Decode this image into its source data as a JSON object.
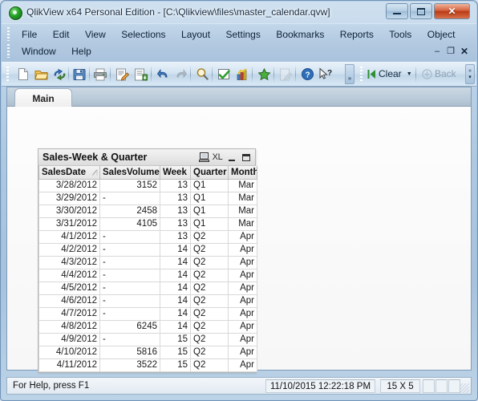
{
  "window": {
    "title": "QlikView x64 Personal Edition - [C:\\Qlikview\\files\\master_calendar.qvw]",
    "app_icon": "qlikview-logo-icon",
    "controls": {
      "minimize": "minimize-icon",
      "maximize": "maximize-icon",
      "close": "✕"
    }
  },
  "menu": {
    "row1": [
      "File",
      "Edit",
      "View",
      "Selections",
      "Layout",
      "Settings",
      "Bookmarks",
      "Reports",
      "Tools",
      "Object"
    ],
    "row2": [
      "Window",
      "Help"
    ],
    "mdi_controls": {
      "minimize": "–",
      "restore": "❐",
      "close": "✕"
    }
  },
  "toolbar": {
    "buttons": [
      {
        "name": "new-document-icon",
        "tip": "New"
      },
      {
        "name": "open-document-icon",
        "tip": "Open"
      },
      {
        "name": "reload-icon",
        "tip": "Reload"
      },
      {
        "name": "save-icon",
        "tip": "Save"
      },
      {
        "name": "print-icon",
        "tip": "Print"
      },
      {
        "name": "edit-script-icon",
        "tip": "Edit Script"
      },
      {
        "name": "table-viewer-icon",
        "tip": "Table Viewer"
      },
      {
        "name": "undo-icon",
        "tip": "Undo"
      },
      {
        "name": "redo-icon",
        "tip": "Redo"
      },
      {
        "name": "search-icon",
        "tip": "Search"
      },
      {
        "name": "current-selections-icon",
        "tip": "Current Selections"
      },
      {
        "name": "chart-icon",
        "tip": "Quick Chart"
      },
      {
        "name": "bookmark-star-icon",
        "tip": "Bookmarks"
      },
      {
        "name": "edit-module-icon",
        "tip": "Edit Module"
      },
      {
        "name": "help-icon",
        "tip": "Help"
      },
      {
        "name": "context-help-icon",
        "tip": "Context Help"
      }
    ],
    "clear_label": "Clear",
    "clear_caret": "▼",
    "back_label": "Back",
    "overflow": "»"
  },
  "document": {
    "tabs": [
      {
        "label": "Main",
        "active": true
      }
    ]
  },
  "table_object": {
    "title": "Sales-Week & Quarter",
    "caption_icons": [
      {
        "name": "copy-to-clipboard-icon",
        "label": ""
      },
      {
        "name": "export-to-excel-icon",
        "label": "XL"
      },
      {
        "name": "minimize-icon",
        "label": ""
      },
      {
        "name": "maximize-icon",
        "label": ""
      }
    ],
    "columns": [
      {
        "key": "salesdate",
        "label": "SalesDate",
        "align": "right",
        "sorted": true
      },
      {
        "key": "salesvolume",
        "label": "SalesVolume",
        "align": "right",
        "sorted": false
      },
      {
        "key": "week",
        "label": "Week",
        "align": "right",
        "sorted": false
      },
      {
        "key": "quarter",
        "label": "Quarter",
        "align": "left",
        "sorted": false
      },
      {
        "key": "month",
        "label": "Month",
        "align": "right",
        "sorted": false
      }
    ],
    "rows": [
      {
        "salesdate": "3/28/2012",
        "salesvolume": "3152",
        "week": "13",
        "quarter": "Q1",
        "month": "Mar"
      },
      {
        "salesdate": "3/29/2012",
        "salesvolume": "-",
        "week": "13",
        "quarter": "Q1",
        "month": "Mar"
      },
      {
        "salesdate": "3/30/2012",
        "salesvolume": "2458",
        "week": "13",
        "quarter": "Q1",
        "month": "Mar"
      },
      {
        "salesdate": "3/31/2012",
        "salesvolume": "4105",
        "week": "13",
        "quarter": "Q1",
        "month": "Mar"
      },
      {
        "salesdate": "4/1/2012",
        "salesvolume": "-",
        "week": "13",
        "quarter": "Q2",
        "month": "Apr"
      },
      {
        "salesdate": "4/2/2012",
        "salesvolume": "-",
        "week": "14",
        "quarter": "Q2",
        "month": "Apr"
      },
      {
        "salesdate": "4/3/2012",
        "salesvolume": "-",
        "week": "14",
        "quarter": "Q2",
        "month": "Apr"
      },
      {
        "salesdate": "4/4/2012",
        "salesvolume": "-",
        "week": "14",
        "quarter": "Q2",
        "month": "Apr"
      },
      {
        "salesdate": "4/5/2012",
        "salesvolume": "-",
        "week": "14",
        "quarter": "Q2",
        "month": "Apr"
      },
      {
        "salesdate": "4/6/2012",
        "salesvolume": "-",
        "week": "14",
        "quarter": "Q2",
        "month": "Apr"
      },
      {
        "salesdate": "4/7/2012",
        "salesvolume": "-",
        "week": "14",
        "quarter": "Q2",
        "month": "Apr"
      },
      {
        "salesdate": "4/8/2012",
        "salesvolume": "6245",
        "week": "14",
        "quarter": "Q2",
        "month": "Apr"
      },
      {
        "salesdate": "4/9/2012",
        "salesvolume": "-",
        "week": "15",
        "quarter": "Q2",
        "month": "Apr"
      },
      {
        "salesdate": "4/10/2012",
        "salesvolume": "5816",
        "week": "15",
        "quarter": "Q2",
        "month": "Apr"
      },
      {
        "salesdate": "4/11/2012",
        "salesvolume": "3522",
        "week": "15",
        "quarter": "Q2",
        "month": "Apr"
      }
    ]
  },
  "statusbar": {
    "help_text": "For Help, press F1",
    "timestamp": "11/10/2015 12:22:18 PM",
    "dimensions": "15 X 5"
  },
  "colors": {
    "title_glass": "#aec8e0",
    "menu_bg": "#b2c9e0",
    "close_button": "#b83a15",
    "sheet_bg": "#fafafa",
    "table_header": "#e6e6e6"
  }
}
